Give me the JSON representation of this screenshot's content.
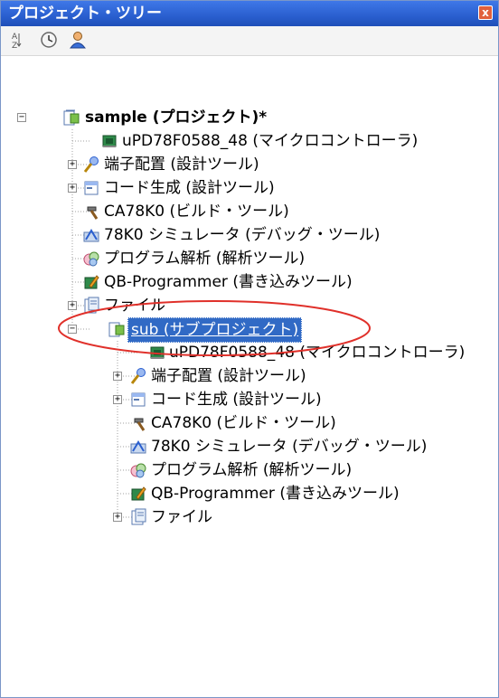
{
  "window": {
    "title": "プロジェクト・ツリー",
    "close_label": "x"
  },
  "toolbar": {
    "sort_icon": "sort-az-icon",
    "clock_icon": "clock-icon",
    "person_icon": "person-icon"
  },
  "tree": {
    "project": {
      "label": "sample (プロジェクト)*",
      "children": [
        "uPD78F0588_48 (マイクロコントローラ)",
        "端子配置 (設計ツール)",
        "コード生成 (設計ツール)",
        "CA78K0 (ビルド・ツール)",
        "78K0 シミュレータ (デバッグ・ツール)",
        "プログラム解析 (解析ツール)",
        "QB-Programmer (書き込みツール)",
        "ファイル"
      ]
    },
    "subproject": {
      "label": "sub (サブプロジェクト)",
      "children": [
        "uPD78F0588_48 (マイクロコントローラ)",
        "端子配置 (設計ツール)",
        "コード生成 (設計ツール)",
        "CA78K0 (ビルド・ツール)",
        "78K0 シミュレータ (デバッグ・ツール)",
        "プログラム解析 (解析ツール)",
        "QB-Programmer (書き込みツール)",
        "ファイル"
      ]
    }
  },
  "colors": {
    "titlebar": "#2a5fcf",
    "selection": "#316ac5",
    "highlight_ellipse": "#e0302a"
  }
}
